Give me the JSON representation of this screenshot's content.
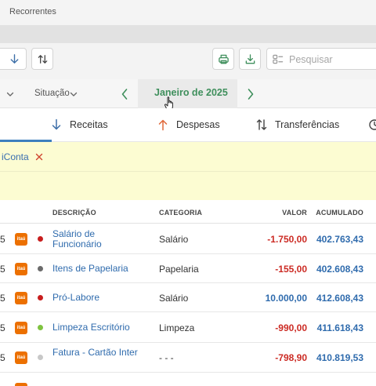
{
  "page": {
    "title": "Recorrentes"
  },
  "toolbar": {
    "search_placeholder": "Pesquisar"
  },
  "filters": {
    "situacao_label": "Situação",
    "month_label": "Janeiro de 2025"
  },
  "type_tabs": {
    "receitas": "Receitas",
    "despesas": "Despesas",
    "transferencias": "Transferências"
  },
  "active_filter_chip": {
    "label": "iConta"
  },
  "table": {
    "headers": {
      "descricao": "DESCRIÇÃO",
      "categoria": "CATEGORIA",
      "valor": "VALOR",
      "acumulado": "ACUMULADO"
    },
    "rows": [
      {
        "day": "5",
        "bank": "itaú",
        "dot_color": "#c81e1e",
        "desc": "Salário de Funcionário",
        "category": "Salário",
        "value": "-1.750,00",
        "value_color": "#cc2b24",
        "acum": "402.763,43"
      },
      {
        "day": "5",
        "bank": "itaú",
        "dot_color": "#6b6b6b",
        "desc": "Itens de Papelaria",
        "category": "Papelaria",
        "value": "-155,00",
        "value_color": "#cc2b24",
        "acum": "402.608,43"
      },
      {
        "day": "5",
        "bank": "itaú",
        "dot_color": "#c81e1e",
        "desc": "Pró-Labore",
        "category": "Salário",
        "value": "10.000,00",
        "value_color": "#2f6bad",
        "acum": "412.608,43"
      },
      {
        "day": "5",
        "bank": "itaú",
        "dot_color": "#7fc340",
        "desc": "Limpeza Escritório",
        "category": "Limpeza",
        "value": "-990,00",
        "value_color": "#cc2b24",
        "acum": "411.618,43"
      },
      {
        "day": "5",
        "bank": "itaú",
        "dot_color": "#c8c8c8",
        "desc": "Fatura - Cartão Inter",
        "category": "- - -",
        "value": "-798,90",
        "value_color": "#cc2b24",
        "acum": "410.819,53"
      }
    ]
  }
}
